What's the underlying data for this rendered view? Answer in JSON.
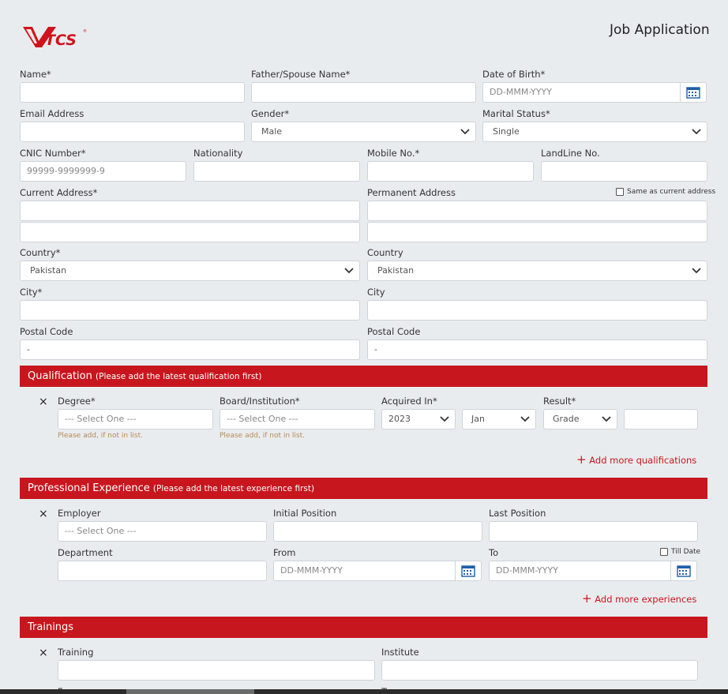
{
  "header": {
    "logo_text": "TCS",
    "title": "Job Application",
    "brand_color": "#c8161e"
  },
  "personal": {
    "name_label": "Name*",
    "father_label": "Father/Spouse Name*",
    "dob_label": "Date of Birth*",
    "dob_placeholder": "DD-MMM-YYYY",
    "email_label": "Email Address",
    "gender_label": "Gender*",
    "gender_value": "Male",
    "marital_label": "Marital Status*",
    "marital_value": "Single",
    "cnic_label": "CNIC Number*",
    "cnic_placeholder": "99999-9999999-9",
    "nationality_label": "Nationality",
    "mobile_label": "Mobile No.*",
    "landline_label": "LandLine No."
  },
  "address": {
    "current_label": "Current Address*",
    "permanent_label": "Permanent Address",
    "same_as_label": "Same as current address",
    "country_label_current": "Country*",
    "country_label_permanent": "Country",
    "country_value_current": "Pakistan",
    "country_value_permanent": "Pakistan",
    "city_label_current": "City*",
    "city_label_permanent": "City",
    "postal_label_current": "Postal Code",
    "postal_label_permanent": "Postal Code",
    "postal_value_current": "-",
    "postal_value_permanent": "-"
  },
  "qualification": {
    "title": "Qualification",
    "note": "(Please add the latest qualification first)",
    "remove_icon": "×",
    "degree_label": "Degree*",
    "degree_value": "--- Select One ---",
    "degree_hint": "Please add, if not in list.",
    "board_label": "Board/Institution*",
    "board_value": "--- Select One ---",
    "board_hint": "Please add, if not in list.",
    "acquired_label": "Acquired In*",
    "year_value": "2023",
    "month_value": "Jan",
    "result_label": "Result*",
    "result_value": "Grade",
    "add_more": "Add more qualifications"
  },
  "experience": {
    "title": "Professional Experience",
    "note": "(Please add the latest experience first)",
    "remove_icon": "×",
    "employer_label": "Employer",
    "employer_value": "--- Select One ---",
    "initial_label": "Initial Position",
    "last_label": "Last Position",
    "department_label": "Department",
    "from_label": "From",
    "from_placeholder": "DD-MMM-YYYY",
    "to_label": "To",
    "to_placeholder": "DD-MMM-YYYY",
    "till_date_label": "Till Date",
    "add_more": "Add more experiences"
  },
  "trainings": {
    "title": "Trainings",
    "remove_icon": "×",
    "training_label": "Training",
    "institute_label": "Institute",
    "from_label_partial": "From",
    "to_label_partial": "To"
  },
  "icons": {
    "calendar": "calendar-icon",
    "chevron": "chevron-down-icon",
    "plus": "plus-icon",
    "close": "close-icon"
  }
}
